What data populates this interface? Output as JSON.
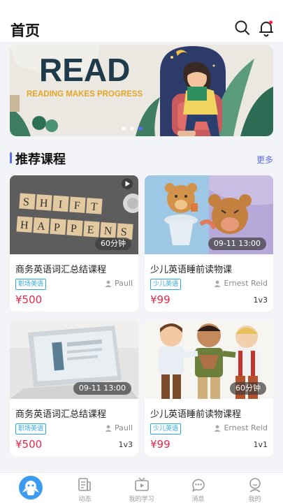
{
  "header": {
    "title": "首页",
    "search_icon": "search-icon",
    "bell_icon": "bell-icon",
    "bell_badge_color": "#e8264a"
  },
  "banner": {
    "headline": "READ",
    "tagline": "READING MAKES PROGRESS",
    "slide_count": 3,
    "active_slide": 3
  },
  "section": {
    "title": "推荐课程",
    "more_label": "更多"
  },
  "courses": [
    {
      "title": "商务英语词汇总结课程",
      "tag": "职场英语",
      "teacher": "Paull",
      "price": "¥500",
      "badge": "60分钟",
      "lessons": ""
    },
    {
      "title": "少儿英语睡前读物课",
      "tag": "少儿英语",
      "teacher": "Ernest Reid",
      "price": "¥99",
      "badge": "09-11 13:00",
      "lessons": "1v3"
    },
    {
      "title": "商务英语词汇总结课程",
      "tag": "职场英语",
      "teacher": "Paull",
      "price": "¥500",
      "badge": "09-11 13:00",
      "lessons": "1v3"
    },
    {
      "title": "少儿英语睡前读物课程",
      "tag": "少儿英语",
      "teacher": "Ernest Reid",
      "price": "¥99",
      "badge": "60分钟",
      "lessons": "1v1"
    }
  ],
  "tabbar": [
    {
      "label": "",
      "icon": "home-icon"
    },
    {
      "label": "动态",
      "icon": "feed-icon"
    },
    {
      "label": "我的学习",
      "icon": "tv-icon"
    },
    {
      "label": "消息",
      "icon": "chat-icon"
    },
    {
      "label": "我的",
      "icon": "profile-icon"
    }
  ],
  "colors": {
    "accent": "#5d6bf2",
    "price": "#e8264a",
    "tag": "#2ba5e6",
    "home_button": "#3b9bf0"
  }
}
